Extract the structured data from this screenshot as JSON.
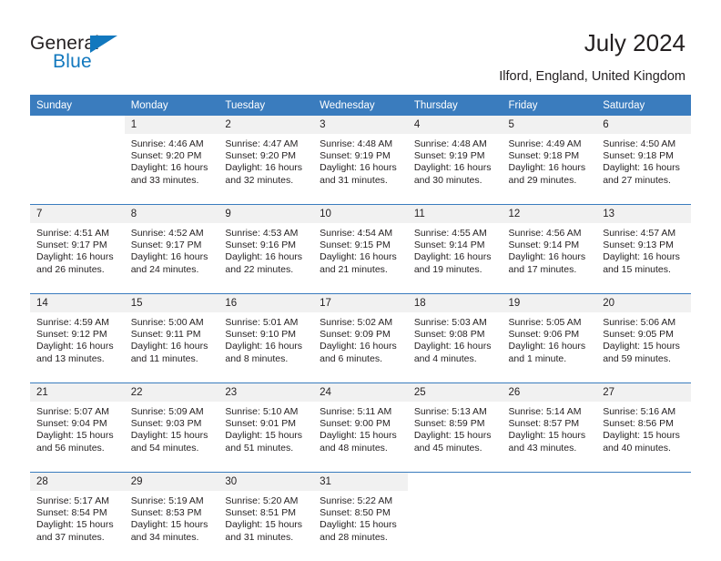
{
  "brand": {
    "name_part1": "General",
    "name_part2": "Blue",
    "accent_color": "#1278be"
  },
  "header": {
    "title": "July 2024",
    "subtitle": "Ilford, England, United Kingdom"
  },
  "calendar": {
    "header_color": "#3a7cbe",
    "daynum_bg": "#f1f1f1",
    "weekdays": [
      "Sunday",
      "Monday",
      "Tuesday",
      "Wednesday",
      "Thursday",
      "Friday",
      "Saturday"
    ],
    "weeks": [
      [
        {
          "day": "",
          "sunrise": "",
          "sunset": "",
          "daylight_1": "",
          "daylight_2": ""
        },
        {
          "day": "1",
          "sunrise": "Sunrise: 4:46 AM",
          "sunset": "Sunset: 9:20 PM",
          "daylight_1": "Daylight: 16 hours",
          "daylight_2": "and 33 minutes."
        },
        {
          "day": "2",
          "sunrise": "Sunrise: 4:47 AM",
          "sunset": "Sunset: 9:20 PM",
          "daylight_1": "Daylight: 16 hours",
          "daylight_2": "and 32 minutes."
        },
        {
          "day": "3",
          "sunrise": "Sunrise: 4:48 AM",
          "sunset": "Sunset: 9:19 PM",
          "daylight_1": "Daylight: 16 hours",
          "daylight_2": "and 31 minutes."
        },
        {
          "day": "4",
          "sunrise": "Sunrise: 4:48 AM",
          "sunset": "Sunset: 9:19 PM",
          "daylight_1": "Daylight: 16 hours",
          "daylight_2": "and 30 minutes."
        },
        {
          "day": "5",
          "sunrise": "Sunrise: 4:49 AM",
          "sunset": "Sunset: 9:18 PM",
          "daylight_1": "Daylight: 16 hours",
          "daylight_2": "and 29 minutes."
        },
        {
          "day": "6",
          "sunrise": "Sunrise: 4:50 AM",
          "sunset": "Sunset: 9:18 PM",
          "daylight_1": "Daylight: 16 hours",
          "daylight_2": "and 27 minutes."
        }
      ],
      [
        {
          "day": "7",
          "sunrise": "Sunrise: 4:51 AM",
          "sunset": "Sunset: 9:17 PM",
          "daylight_1": "Daylight: 16 hours",
          "daylight_2": "and 26 minutes."
        },
        {
          "day": "8",
          "sunrise": "Sunrise: 4:52 AM",
          "sunset": "Sunset: 9:17 PM",
          "daylight_1": "Daylight: 16 hours",
          "daylight_2": "and 24 minutes."
        },
        {
          "day": "9",
          "sunrise": "Sunrise: 4:53 AM",
          "sunset": "Sunset: 9:16 PM",
          "daylight_1": "Daylight: 16 hours",
          "daylight_2": "and 22 minutes."
        },
        {
          "day": "10",
          "sunrise": "Sunrise: 4:54 AM",
          "sunset": "Sunset: 9:15 PM",
          "daylight_1": "Daylight: 16 hours",
          "daylight_2": "and 21 minutes."
        },
        {
          "day": "11",
          "sunrise": "Sunrise: 4:55 AM",
          "sunset": "Sunset: 9:14 PM",
          "daylight_1": "Daylight: 16 hours",
          "daylight_2": "and 19 minutes."
        },
        {
          "day": "12",
          "sunrise": "Sunrise: 4:56 AM",
          "sunset": "Sunset: 9:14 PM",
          "daylight_1": "Daylight: 16 hours",
          "daylight_2": "and 17 minutes."
        },
        {
          "day": "13",
          "sunrise": "Sunrise: 4:57 AM",
          "sunset": "Sunset: 9:13 PM",
          "daylight_1": "Daylight: 16 hours",
          "daylight_2": "and 15 minutes."
        }
      ],
      [
        {
          "day": "14",
          "sunrise": "Sunrise: 4:59 AM",
          "sunset": "Sunset: 9:12 PM",
          "daylight_1": "Daylight: 16 hours",
          "daylight_2": "and 13 minutes."
        },
        {
          "day": "15",
          "sunrise": "Sunrise: 5:00 AM",
          "sunset": "Sunset: 9:11 PM",
          "daylight_1": "Daylight: 16 hours",
          "daylight_2": "and 11 minutes."
        },
        {
          "day": "16",
          "sunrise": "Sunrise: 5:01 AM",
          "sunset": "Sunset: 9:10 PM",
          "daylight_1": "Daylight: 16 hours",
          "daylight_2": "and 8 minutes."
        },
        {
          "day": "17",
          "sunrise": "Sunrise: 5:02 AM",
          "sunset": "Sunset: 9:09 PM",
          "daylight_1": "Daylight: 16 hours",
          "daylight_2": "and 6 minutes."
        },
        {
          "day": "18",
          "sunrise": "Sunrise: 5:03 AM",
          "sunset": "Sunset: 9:08 PM",
          "daylight_1": "Daylight: 16 hours",
          "daylight_2": "and 4 minutes."
        },
        {
          "day": "19",
          "sunrise": "Sunrise: 5:05 AM",
          "sunset": "Sunset: 9:06 PM",
          "daylight_1": "Daylight: 16 hours",
          "daylight_2": "and 1 minute."
        },
        {
          "day": "20",
          "sunrise": "Sunrise: 5:06 AM",
          "sunset": "Sunset: 9:05 PM",
          "daylight_1": "Daylight: 15 hours",
          "daylight_2": "and 59 minutes."
        }
      ],
      [
        {
          "day": "21",
          "sunrise": "Sunrise: 5:07 AM",
          "sunset": "Sunset: 9:04 PM",
          "daylight_1": "Daylight: 15 hours",
          "daylight_2": "and 56 minutes."
        },
        {
          "day": "22",
          "sunrise": "Sunrise: 5:09 AM",
          "sunset": "Sunset: 9:03 PM",
          "daylight_1": "Daylight: 15 hours",
          "daylight_2": "and 54 minutes."
        },
        {
          "day": "23",
          "sunrise": "Sunrise: 5:10 AM",
          "sunset": "Sunset: 9:01 PM",
          "daylight_1": "Daylight: 15 hours",
          "daylight_2": "and 51 minutes."
        },
        {
          "day": "24",
          "sunrise": "Sunrise: 5:11 AM",
          "sunset": "Sunset: 9:00 PM",
          "daylight_1": "Daylight: 15 hours",
          "daylight_2": "and 48 minutes."
        },
        {
          "day": "25",
          "sunrise": "Sunrise: 5:13 AM",
          "sunset": "Sunset: 8:59 PM",
          "daylight_1": "Daylight: 15 hours",
          "daylight_2": "and 45 minutes."
        },
        {
          "day": "26",
          "sunrise": "Sunrise: 5:14 AM",
          "sunset": "Sunset: 8:57 PM",
          "daylight_1": "Daylight: 15 hours",
          "daylight_2": "and 43 minutes."
        },
        {
          "day": "27",
          "sunrise": "Sunrise: 5:16 AM",
          "sunset": "Sunset: 8:56 PM",
          "daylight_1": "Daylight: 15 hours",
          "daylight_2": "and 40 minutes."
        }
      ],
      [
        {
          "day": "28",
          "sunrise": "Sunrise: 5:17 AM",
          "sunset": "Sunset: 8:54 PM",
          "daylight_1": "Daylight: 15 hours",
          "daylight_2": "and 37 minutes."
        },
        {
          "day": "29",
          "sunrise": "Sunrise: 5:19 AM",
          "sunset": "Sunset: 8:53 PM",
          "daylight_1": "Daylight: 15 hours",
          "daylight_2": "and 34 minutes."
        },
        {
          "day": "30",
          "sunrise": "Sunrise: 5:20 AM",
          "sunset": "Sunset: 8:51 PM",
          "daylight_1": "Daylight: 15 hours",
          "daylight_2": "and 31 minutes."
        },
        {
          "day": "31",
          "sunrise": "Sunrise: 5:22 AM",
          "sunset": "Sunset: 8:50 PM",
          "daylight_1": "Daylight: 15 hours",
          "daylight_2": "and 28 minutes."
        },
        {
          "day": "",
          "sunrise": "",
          "sunset": "",
          "daylight_1": "",
          "daylight_2": ""
        },
        {
          "day": "",
          "sunrise": "",
          "sunset": "",
          "daylight_1": "",
          "daylight_2": ""
        },
        {
          "day": "",
          "sunrise": "",
          "sunset": "",
          "daylight_1": "",
          "daylight_2": ""
        }
      ]
    ]
  }
}
